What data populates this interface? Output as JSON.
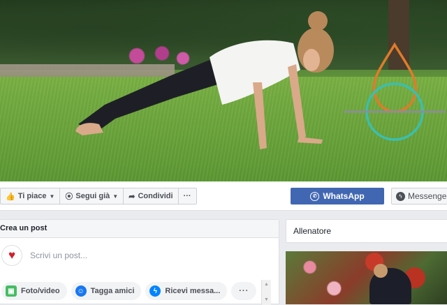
{
  "action_bar": {
    "like_label": "Ti piace",
    "follow_label": "Segui già",
    "share_label": "Condividi",
    "more_label": "···",
    "whatsapp_label": "WhatsApp",
    "messenger_label": "Messenger"
  },
  "create_post": {
    "header": "Crea un post",
    "placeholder": "Scrivi un post...",
    "chips": [
      {
        "label": "Foto/video",
        "icon": "photo-icon"
      },
      {
        "label": "Tagga amici",
        "icon": "tag-friends-icon"
      },
      {
        "label": "Ricevi messa...",
        "icon": "messenger-icon"
      },
      {
        "label": "···",
        "icon": "more-icon"
      }
    ]
  },
  "sidebar": {
    "card_title": "Allenatore"
  },
  "colors": {
    "facebook_blue": "#4267b2",
    "logo_orange": "#e07b2a",
    "logo_teal": "#3bbfb0"
  }
}
